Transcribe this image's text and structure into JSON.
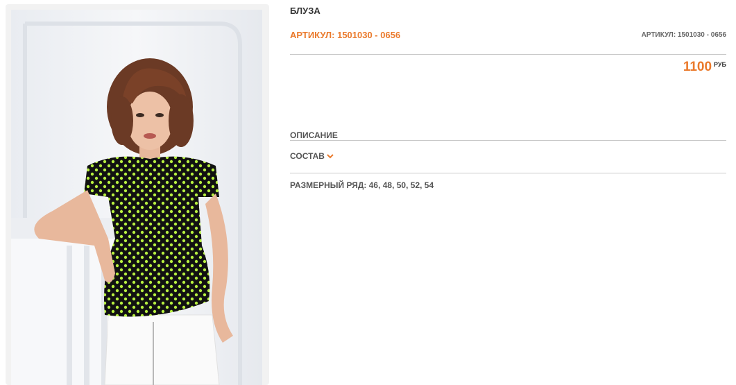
{
  "product": {
    "title": "БЛУЗА",
    "article_main": "АРТИКУЛ: 1501030 - 0656",
    "article_small": "АРТИКУЛ: 1501030 - 0656",
    "price": "1100",
    "currency": "РУБ",
    "image_alt": "Блуза"
  },
  "sections": {
    "description_label": "ОПИСАНИЕ",
    "composition_label": "СОСТАВ",
    "sizes_label": "РАЗМЕРНЫЙ РЯД: 46, 48, 50, 52, 54"
  },
  "colors": {
    "accent": "#ea7a2c",
    "text": "#333333",
    "divider": "#c9c9c9"
  },
  "icons": {
    "composition_toggle": "chevron-down-icon"
  }
}
